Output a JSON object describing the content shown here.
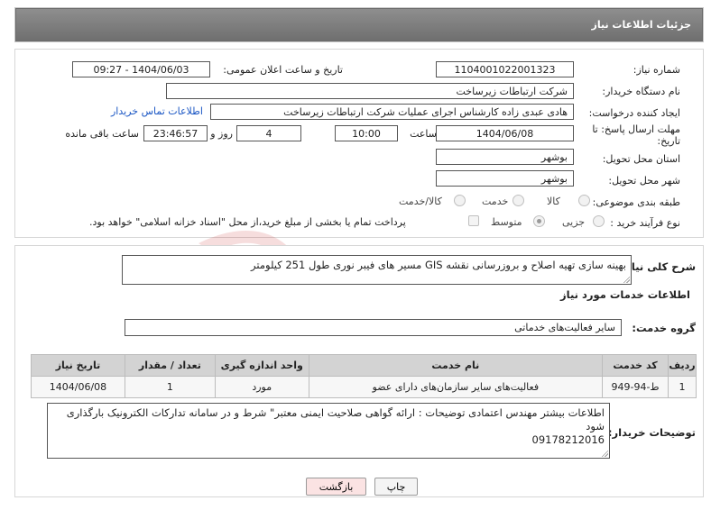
{
  "header": {
    "title": "جزئیات اطلاعات نیاز"
  },
  "fields": {
    "need_number_label": "شماره نیاز:",
    "need_number": "1104001022001323",
    "announce_label": "تاریخ و ساعت اعلان عمومی:",
    "announce_value": "1404/06/03 - 09:27",
    "buyer_org_label": "نام دستگاه خریدار:",
    "buyer_org": "شرکت ارتباطات زیرساخت",
    "creator_label": "ایجاد کننده درخواست:",
    "creator": "هادی عبدی زاده کارشناس اجرای عملیات شرکت ارتباطات زیرساخت",
    "contact_link": "اطلاعات تماس خریدار",
    "deadline_label_1": "مهلت ارسال پاسخ: تا",
    "deadline_label_2": "تاریخ:",
    "deadline_date": "1404/06/08",
    "time_label": "ساعت",
    "deadline_time": "10:00",
    "days_value": "4",
    "days_label": "روز و",
    "remaining_time": "23:46:57",
    "remaining_label": "ساعت باقی مانده",
    "province_label": "استان محل تحویل:",
    "province": "بوشهر",
    "city_label": "شهر محل تحویل:",
    "city": "بوشهر",
    "category_label": "طبقه بندی موضوعی:",
    "category_options": [
      "کالا",
      "خدمت",
      "کالا/خدمت"
    ],
    "process_label": "نوع فرآیند خرید :",
    "process_options": [
      "جزیی",
      "متوسط"
    ],
    "payment_note": "پرداخت تمام یا بخشی از مبلغ خرید،از محل \"اسناد خزانه اسلامی\" خواهد بود."
  },
  "details": {
    "summary_label": "شرح کلی نیاز:",
    "summary": "بهینه سازی تهیه اصلاح و بروزرسانی نقشه GIS مسیر های فیبر نوری طول 251 کیلومتر",
    "services_title": "اطلاعات خدمات مورد نیاز",
    "service_group_label": "گروه خدمت:",
    "service_group": "سایر فعالیت‌های خدماتی",
    "table": {
      "headers": [
        "ردیف",
        "کد خدمت",
        "نام خدمت",
        "واحد اندازه گیری",
        "تعداد / مقدار",
        "تاریخ نیاز"
      ],
      "rows": [
        [
          "1",
          "ط-94-949",
          "فعالیت‌های سایر سازمان‌های دارای عضو",
          "مورد",
          "1",
          "1404/06/08"
        ]
      ]
    },
    "buyer_notes_label": "توضیحات خریدار:",
    "buyer_notes_line1": "اطلاعات بیشتر مهندس اعتمادی توضیحات : ارائه گواهی صلاحیت ایمنی معتبر\" شرط و در سامانه تدارکات الکترونیک بارگذاری شود",
    "buyer_notes_line2": "09178212016"
  },
  "buttons": {
    "print": "چاپ",
    "back": "بازگشت"
  },
  "colors": {
    "header_bg": "#7f7f7f",
    "link": "#1a56c4",
    "back_button_bg": "#fbe3e3"
  }
}
